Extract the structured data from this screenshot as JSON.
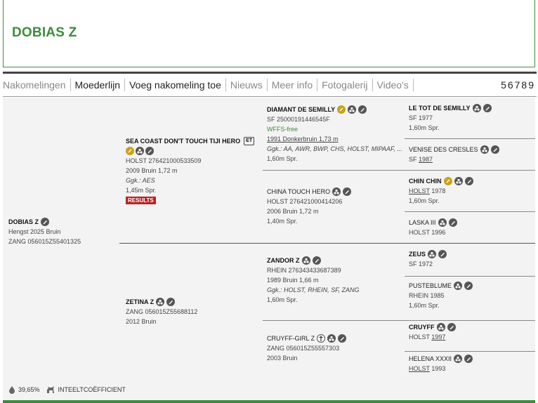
{
  "header": {
    "title": "DOBIAS Z"
  },
  "tabs": [
    {
      "label": "Nakomelingen",
      "state": "dim"
    },
    {
      "label": "Moederlijn",
      "state": "active"
    },
    {
      "label": "Voeg nakomeling toe",
      "state": "active"
    },
    {
      "label": "Nieuws",
      "state": "dim"
    },
    {
      "label": "Meer info",
      "state": "dim"
    },
    {
      "label": "Fotogalerij",
      "state": "dim"
    },
    {
      "label": "Video's",
      "state": "dim"
    }
  ],
  "pages": "56789",
  "subject": {
    "name": "DOBIAS Z",
    "line1": "Hengst 2025 Bruin",
    "line2": "ZANG 056015Z55401325"
  },
  "sire": {
    "name": "SEA COAST DON'T TOUCH TIJI HERO",
    "badge": "ET",
    "line1": "HOLST 276421000533509",
    "line2": "2009 Bruin 1,72 m",
    "line3": "Ggk.: AES",
    "line4": "1,45m Spr.",
    "results": "RESULTS"
  },
  "dam": {
    "name": "ZETINA Z",
    "line1": "ZANG 056015Z55688112",
    "line2": "2012 Bruin"
  },
  "ss": {
    "name": "DIAMANT DE SEMILLY",
    "line1": "SF 25000191446545F",
    "line2": "WFFS-free",
    "line3": "1991 Donkerbruin 1,73 m",
    "line4": "Ggk.: AA, AWR, BWP, CHS, HOLST, MIPAAF, ...",
    "line5": "1,60m Spr."
  },
  "sd": {
    "name": "CHINA TOUCH HERO",
    "line1": "HOLST 276421000414206",
    "line2": "2006 Bruin 1,72 m",
    "line3": "1,40m Spr."
  },
  "ds": {
    "name": "ZANDOR Z",
    "line1": "RHEIN 276343433687389",
    "line2": "1989 Bruin 1,66 m",
    "line3": "Ggk.: HOLST, RHEIN, SF, ZANG",
    "line4": "1,60m Spr."
  },
  "dd": {
    "name": "CRUYFF-GIRL Z",
    "line1": "ZANG 056015Z55557303",
    "line2": "2003 Bruin"
  },
  "sss": {
    "name": "LE TOT DE SEMILLY",
    "line1": "SF 1977",
    "line2": "1,60m Spr."
  },
  "ssd": {
    "name": "VENISE DES CRESLES",
    "line1": "SF",
    "line1b": "1987"
  },
  "sds": {
    "name": "CHIN CHIN",
    "line1": "HOLST",
    "line1b": "1978",
    "line2": "1,60m Spr."
  },
  "sdd": {
    "name": "LASKA III",
    "line1": "HOLST 1996"
  },
  "dss": {
    "name": "ZEUS",
    "line1": "SF 1972"
  },
  "dsd": {
    "name": "PUSTEBLUME",
    "line1": "RHEIN 1985",
    "line2": "1,60m Spr."
  },
  "dds": {
    "name": "CRUYFF",
    "line1": "HOLST",
    "line1b": "1997"
  },
  "ddd": {
    "name": "HELENA XXXII",
    "line1": "HOLST",
    "line1b": "1993"
  },
  "footer": {
    "percent": "39,65%",
    "label": "INTEELTCOËFFICIENT"
  },
  "colors": {
    "brand_green": "#3d8b3d",
    "results_red": "#b22222",
    "gold_icon": "#c9a317"
  }
}
